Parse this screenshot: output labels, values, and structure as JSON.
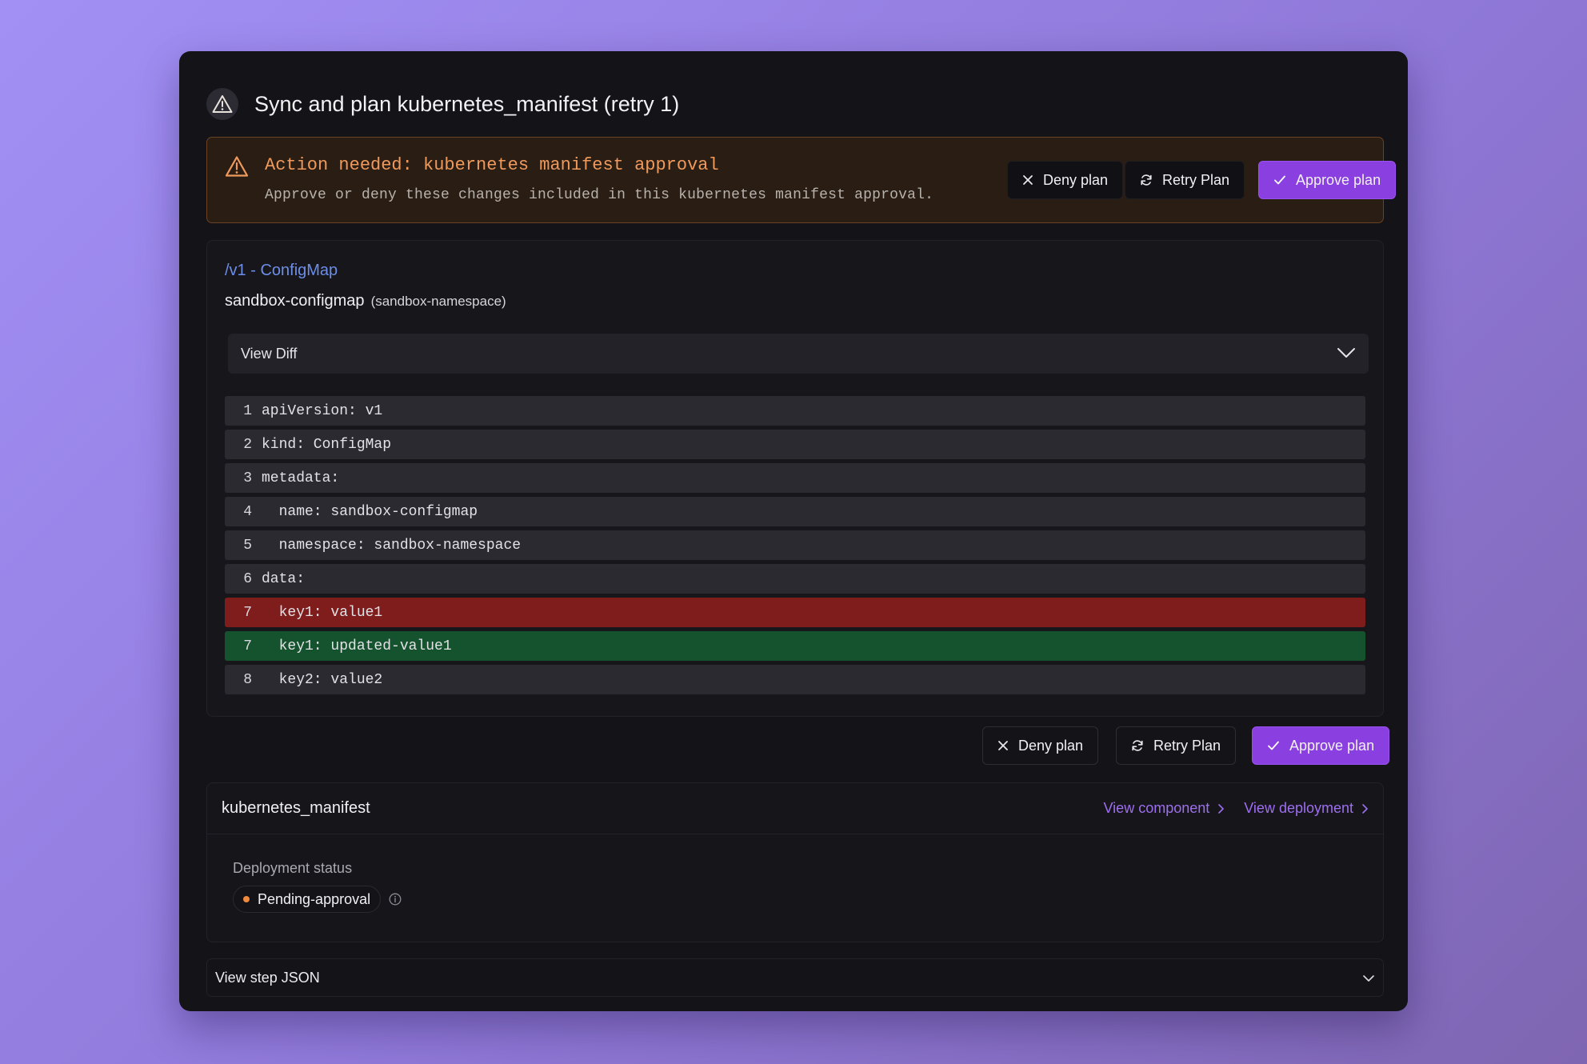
{
  "header": {
    "title": "Sync and plan kubernetes_manifest (retry 1)"
  },
  "alert": {
    "title": "Action needed: kubernetes manifest approval",
    "description": "Approve or deny these changes included in this kubernetes manifest approval."
  },
  "actions": {
    "deny_label": "Deny plan",
    "retry_label": "Retry Plan",
    "approve_label": "Approve plan"
  },
  "resource": {
    "api": "/v1 - ConfigMap",
    "name": "sandbox-configmap",
    "namespace": "(sandbox-namespace)",
    "diff_toggle_label": "View Diff",
    "diff_lines": [
      {
        "num": "1",
        "text": "apiVersion: v1",
        "type": "context"
      },
      {
        "num": "2",
        "text": "kind: ConfigMap",
        "type": "context"
      },
      {
        "num": "3",
        "text": "metadata:",
        "type": "context"
      },
      {
        "num": "4",
        "text": "  name: sandbox-configmap",
        "type": "context"
      },
      {
        "num": "5",
        "text": "  namespace: sandbox-namespace",
        "type": "context"
      },
      {
        "num": "6",
        "text": "data:",
        "type": "context"
      },
      {
        "num": "7",
        "text": "  key1: value1",
        "type": "removed"
      },
      {
        "num": "7",
        "text": "  key1: updated-value1",
        "type": "added"
      },
      {
        "num": "8",
        "text": "  key2: value2",
        "type": "context"
      }
    ]
  },
  "component": {
    "title": "kubernetes_manifest",
    "view_component_label": "View component",
    "view_deployment_label": "View deployment",
    "status_label": "Deployment status",
    "status_value": "Pending-approval"
  },
  "step_json": {
    "label": "View step JSON"
  },
  "colors": {
    "accent": "#8a3fe0",
    "link": "#9d6ff0",
    "api_link": "#6d8ee8",
    "warning": "#ef9a5c",
    "removed": "#7f1d1d",
    "added": "#14532d",
    "status_dot": "#f08a3c"
  }
}
